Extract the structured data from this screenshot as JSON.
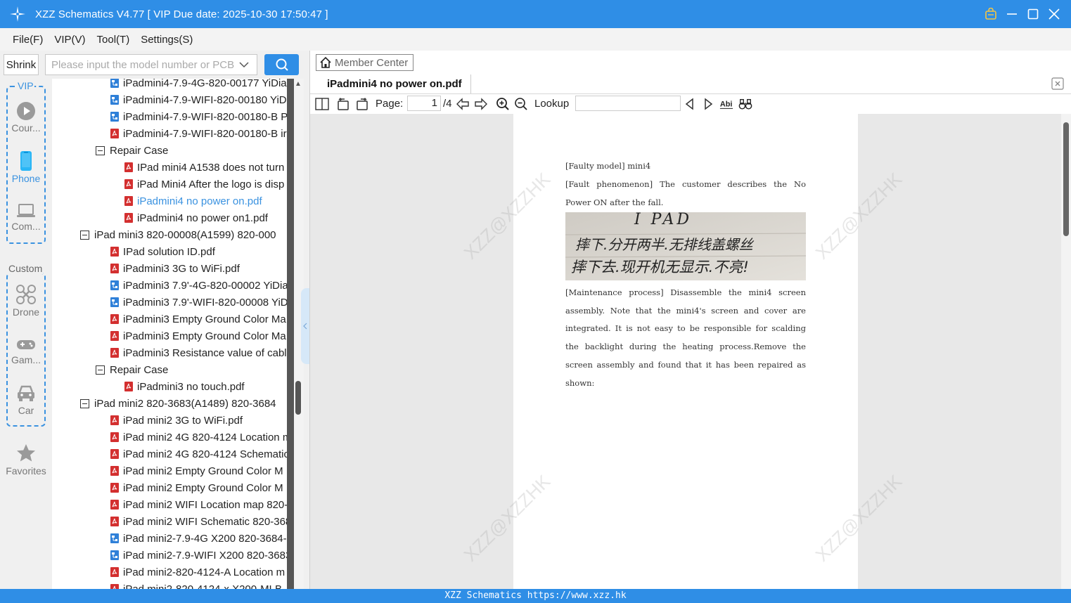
{
  "window": {
    "title": "XZZ Schematics V4.77 [ VIP Due date: 2025-10-30 17:50:47 ]"
  },
  "menu": [
    "File(F)",
    "VIP(V)",
    "Tool(T)",
    "Settings(S)"
  ],
  "search": {
    "shrink_label": "Shrink",
    "placeholder": "Please input the model number or PCB"
  },
  "sidebar": {
    "vip_group_label": "VIP",
    "custom_group_label": "Custom",
    "items": [
      {
        "label": "Cour...",
        "icon": "play-circle-icon"
      },
      {
        "label": "Phone",
        "icon": "phone-icon"
      },
      {
        "label": "Com...",
        "icon": "laptop-icon"
      },
      {
        "label": "Drone",
        "icon": "drone-icon"
      },
      {
        "label": "Gam...",
        "icon": "gamepad-icon"
      },
      {
        "label": "Car",
        "icon": "car-icon"
      },
      {
        "label": "Favorites",
        "icon": "star-icon"
      }
    ]
  },
  "tree": [
    {
      "text": "iPadmini4-7.9-4G-820-00177 YiDia",
      "type": "schematic",
      "level": 2
    },
    {
      "text": "iPadmini4-7.9-WIFI-820-00180 YiD",
      "type": "schematic",
      "level": 2
    },
    {
      "text": "iPadmini4-7.9-WIFI-820-00180-B P",
      "type": "schematic",
      "level": 2
    },
    {
      "text": "iPadmini4-7.9-WIFI-820-00180-B ir",
      "type": "pdf",
      "level": 2
    },
    {
      "text": "Repair Case",
      "type": "folder",
      "level": 2
    },
    {
      "text": "IPad mini4 A1538 does not turn",
      "type": "pdf",
      "level": 3
    },
    {
      "text": "iPad Mini4 After the logo is disp",
      "type": "pdf",
      "level": 3
    },
    {
      "text": "iPadmini4 no power on.pdf",
      "type": "pdf",
      "level": 3,
      "selected": true
    },
    {
      "text": "iPadmini4 no power on1.pdf",
      "type": "pdf",
      "level": 3
    },
    {
      "text": "iPad mini3 820-00008(A1599) 820-000",
      "type": "folder",
      "level": 1
    },
    {
      "text": "IPad solution ID.pdf",
      "type": "pdf",
      "level": 2
    },
    {
      "text": "iPadmini3 3G to WiFi.pdf",
      "type": "pdf",
      "level": 2
    },
    {
      "text": "iPadmini3 7.9'-4G-820-00002 YiDia",
      "type": "schematic",
      "level": 2
    },
    {
      "text": "iPadmini3 7.9'-WIFI-820-00008 YiD",
      "type": "schematic",
      "level": 2
    },
    {
      "text": "iPadmini3 Empty Ground Color Ma",
      "type": "pdf",
      "level": 2
    },
    {
      "text": "iPadmini3 Empty Ground Color Ma",
      "type": "pdf",
      "level": 2
    },
    {
      "text": "iPadmini3 Resistance value of cabl",
      "type": "pdf",
      "level": 2
    },
    {
      "text": "Repair Case",
      "type": "folder",
      "level": 2
    },
    {
      "text": "iPadmini3 no touch.pdf",
      "type": "pdf",
      "level": 3
    },
    {
      "text": "iPad mini2 820-3683(A1489) 820-3684",
      "type": "folder",
      "level": 1
    },
    {
      "text": "iPad mini2 3G to WiFi.pdf",
      "type": "pdf",
      "level": 2
    },
    {
      "text": "iPad mini2 4G 820-4124 Location m",
      "type": "pdf",
      "level": 2
    },
    {
      "text": "iPad mini2 4G 820-4124 Schematic",
      "type": "pdf",
      "level": 2
    },
    {
      "text": "iPad mini2 Empty Ground Color M",
      "type": "pdf",
      "level": 2
    },
    {
      "text": "iPad mini2 Empty Ground Color M",
      "type": "pdf",
      "level": 2
    },
    {
      "text": "iPad mini2 WIFI Location map 820-",
      "type": "pdf",
      "level": 2
    },
    {
      "text": "iPad mini2 WIFI Schematic 820-368",
      "type": "pdf",
      "level": 2
    },
    {
      "text": "iPad mini2-7.9-4G X200 820-3684-",
      "type": "schematic",
      "level": 2
    },
    {
      "text": "iPad mini2-7.9-WIFI X200 820-3683",
      "type": "schematic",
      "level": 2
    },
    {
      "text": "iPad mini2-820-4124-A Location m",
      "type": "pdf",
      "level": 2
    },
    {
      "text": "iPad mini2-820-4124-x X200-MLB",
      "type": "pdf",
      "level": 2
    }
  ],
  "member_center_label": "Member Center",
  "document_tab": "iPadmini4 no power on.pdf",
  "pdf_toolbar": {
    "page_label": "Page:",
    "page_value": "1",
    "page_total": "/4",
    "lookup_label": "Lookup"
  },
  "pdf_page": {
    "line1": "[Faulty model] mini4",
    "line2": "[Fault phenomenon] The customer describes the No Power ON after the fall.",
    "line3": "[Maintenance process] Disassemble the mini4 screen assembly. Note that the mini4's screen and cover are integrated. It is not easy to be responsible for scalding the backlight during the heating process.Remove the screen assembly and found that it has been repaired as shown:",
    "photo_handwriting_1": "I PAD",
    "photo_handwriting_2": "摔下.分开两半.无排线盖螺丝",
    "photo_handwriting_3": "摔下去.现开机无显示.不亮!",
    "watermark": "XZZ@XZZHK"
  },
  "status_bar": "XZZ Schematics https://www.xzz.hk",
  "colors": {
    "accent": "#2f8ee6",
    "pdf_icon": "#d32f2f",
    "schematic_icon": "#2f80d8",
    "link": "#3a92e0"
  }
}
